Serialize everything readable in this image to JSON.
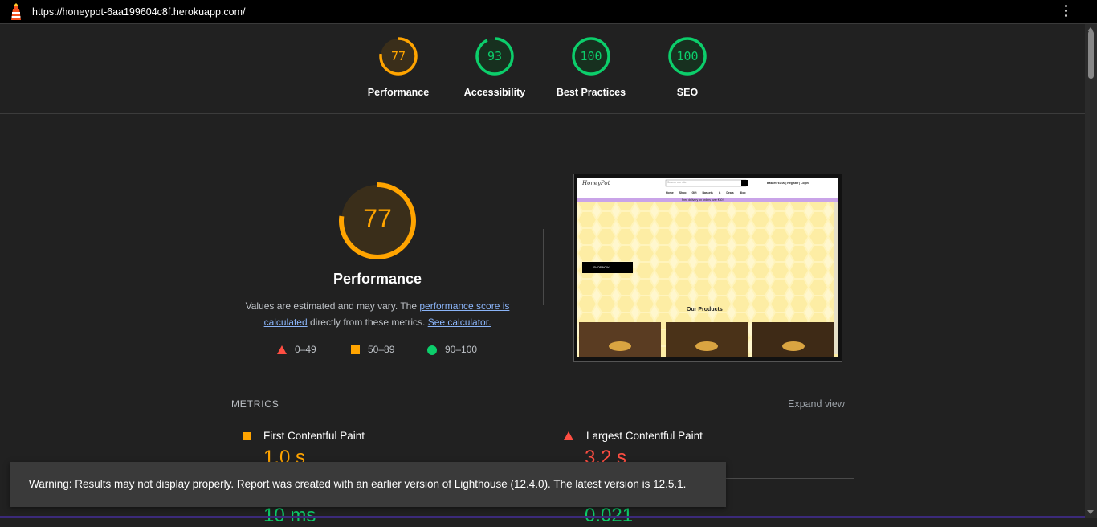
{
  "browser": {
    "url": "https://honeypot-6aa199604c8f.herokuapp.com/"
  },
  "categories": [
    {
      "label": "Performance",
      "score": "77",
      "value": 77,
      "color": "#ffa400"
    },
    {
      "label": "Accessibility",
      "score": "93",
      "value": 93,
      "color": "#0cce6b"
    },
    {
      "label": "Best Practices",
      "score": "100",
      "value": 100,
      "color": "#0cce6b"
    },
    {
      "label": "SEO",
      "score": "100",
      "value": 100,
      "color": "#0cce6b"
    }
  ],
  "performance": {
    "score": "77",
    "value": 77,
    "title": "Performance",
    "desc_prefix": "Values are estimated and may vary. The ",
    "link1": "performance score is calculated",
    "desc_mid": " directly from these metrics. ",
    "link2": "See calculator."
  },
  "legend": [
    {
      "label": "0–49",
      "shape": "triangle",
      "color": "#ff4e42"
    },
    {
      "label": "50–89",
      "shape": "square",
      "color": "#ffa400"
    },
    {
      "label": "90–100",
      "shape": "circle",
      "color": "#0cce6b"
    }
  ],
  "thumbnail": {
    "search_placeholder": "Search our site",
    "basket": "Basket: €0.00 | Register | Login",
    "nav": [
      "Home",
      "Shop",
      "Gift Baskets & Deals",
      "Blog"
    ],
    "promo": "Free delivery on orders over €50!",
    "shop_now": "SHOP NOW",
    "our_products": "Our Products"
  },
  "metrics": {
    "heading": "METRICS",
    "expand": "Expand view",
    "items": [
      {
        "label": "First Contentful Paint",
        "value": "1.0 s",
        "status": "average",
        "color": "#ffa400"
      },
      {
        "label": "Largest Contentful Paint",
        "value": "3.2 s",
        "status": "fail",
        "color": "#ff4e42"
      }
    ],
    "partial": [
      {
        "value": "10 ms",
        "color": "#0cce6b"
      },
      {
        "value": "0.021",
        "color": "#0cce6b"
      }
    ]
  },
  "warning": "Warning: Results may not display properly. Report was created with an earlier version of Lighthouse (12.4.0). The latest version is 12.5.1."
}
